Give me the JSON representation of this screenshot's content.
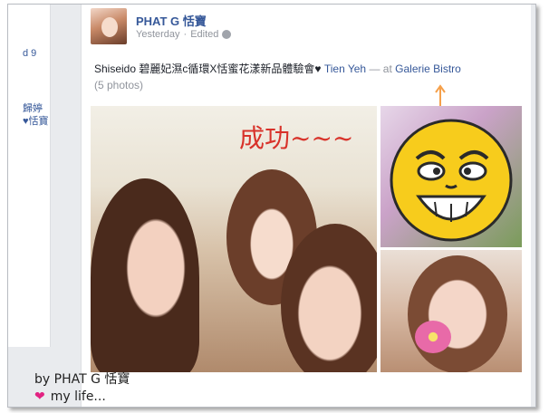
{
  "left_column": {
    "snippet_1": "d 9",
    "snippet_2a": "歸婷",
    "snippet_2b": "♥恬寶"
  },
  "post": {
    "author": "PHAT G 恬寶",
    "timestamp": "Yesterday",
    "edited": "Edited",
    "meta_separator": "·",
    "status_text": "Shiseido 碧麗妃濕c循環X恬蜜花漾新品體驗會♥",
    "tagged_person": "Tien Yeh",
    "at_text": "— at",
    "location": "Galerie Bistro",
    "photo_count": "(5 photos)"
  },
  "photos": {
    "overlay_text": "成功~~~"
  },
  "watermark": {
    "line1": "by PHAT G 恬寶",
    "line2": "my life..."
  },
  "colors": {
    "link": "#365899",
    "muted": "#90949c",
    "overlay_red": "#d8322a",
    "arrow_orange": "#f5a04a",
    "heart_pink": "#e22382"
  },
  "icons": [
    "globe-icon",
    "up-arrow-icon",
    "heart-icon",
    "smiley-sticker"
  ]
}
